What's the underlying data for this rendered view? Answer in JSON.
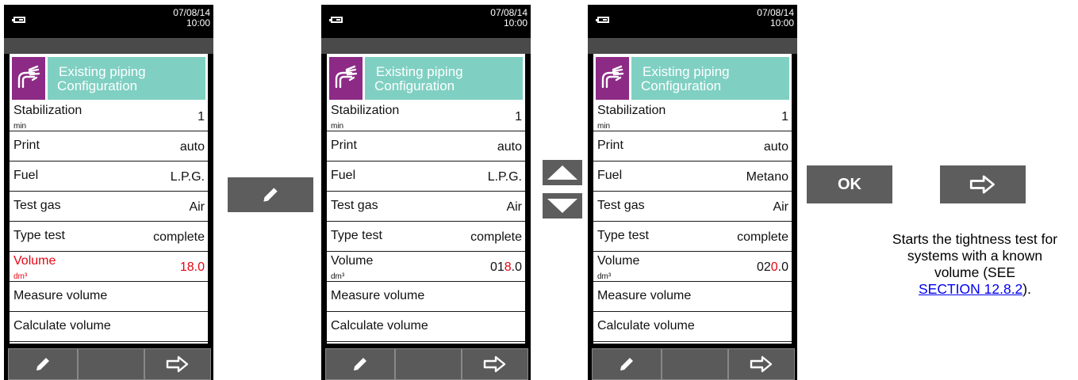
{
  "status": {
    "date": "07/08/14",
    "time": "10:00"
  },
  "header": {
    "line1": "Existing piping",
    "line2": "Configuration"
  },
  "screens": [
    {
      "rows": [
        {
          "label": "Stabilization",
          "unit": "min",
          "value": "1"
        },
        {
          "label": "Print",
          "value": "auto"
        },
        {
          "label": "Fuel",
          "value": "L.P.G."
        },
        {
          "label": "Test gas",
          "value": "Air"
        },
        {
          "label": "Type test",
          "value": "complete"
        },
        {
          "label": "Volume",
          "unit": "dm³",
          "value": "18.0"
        },
        {
          "label": "Measure volume"
        },
        {
          "label": "Calculate volume"
        }
      ]
    },
    {
      "rows": [
        {
          "label": "Stabilization",
          "unit": "min",
          "value": "1"
        },
        {
          "label": "Print",
          "value": "auto"
        },
        {
          "label": "Fuel",
          "value": "L.P.G."
        },
        {
          "label": "Test gas",
          "value": "Air"
        },
        {
          "label": "Type test",
          "value": "complete"
        },
        {
          "label": "Volume",
          "unit": "dm³",
          "value_pre": "01",
          "value_hl": "8",
          "value_post": ".0"
        },
        {
          "label": "Measure volume"
        },
        {
          "label": "Calculate volume"
        }
      ]
    },
    {
      "rows": [
        {
          "label": "Stabilization",
          "unit": "min",
          "value": "1"
        },
        {
          "label": "Print",
          "value": "auto"
        },
        {
          "label": "Fuel",
          "value": "Metano"
        },
        {
          "label": "Test gas",
          "value": "Air"
        },
        {
          "label": "Type test",
          "value": "complete"
        },
        {
          "label": "Volume",
          "unit": "dm³",
          "value_pre": "02",
          "value_hl": "0",
          "value_post": ".0"
        },
        {
          "label": "Measure volume"
        },
        {
          "label": "Calculate volume"
        }
      ]
    }
  ],
  "controls": {
    "ok_label": "OK"
  },
  "note": {
    "text": "Starts the tightness test for systems with a known volume (SEE",
    "link": "SECTION 12.8.2",
    "suffix": ")."
  },
  "icons": {
    "header": "pipe-hand-icon",
    "edit": "pencil-icon",
    "next": "arrow-right-icon",
    "up": "triangle-up-icon",
    "down": "triangle-down-icon",
    "battery": "battery-icon"
  },
  "colors": {
    "header_icon_bg": "#8c2a86",
    "header_title_bg": "#7fd0c2",
    "selected_red": "#e30613",
    "button_gray": "#5d5d5d"
  }
}
